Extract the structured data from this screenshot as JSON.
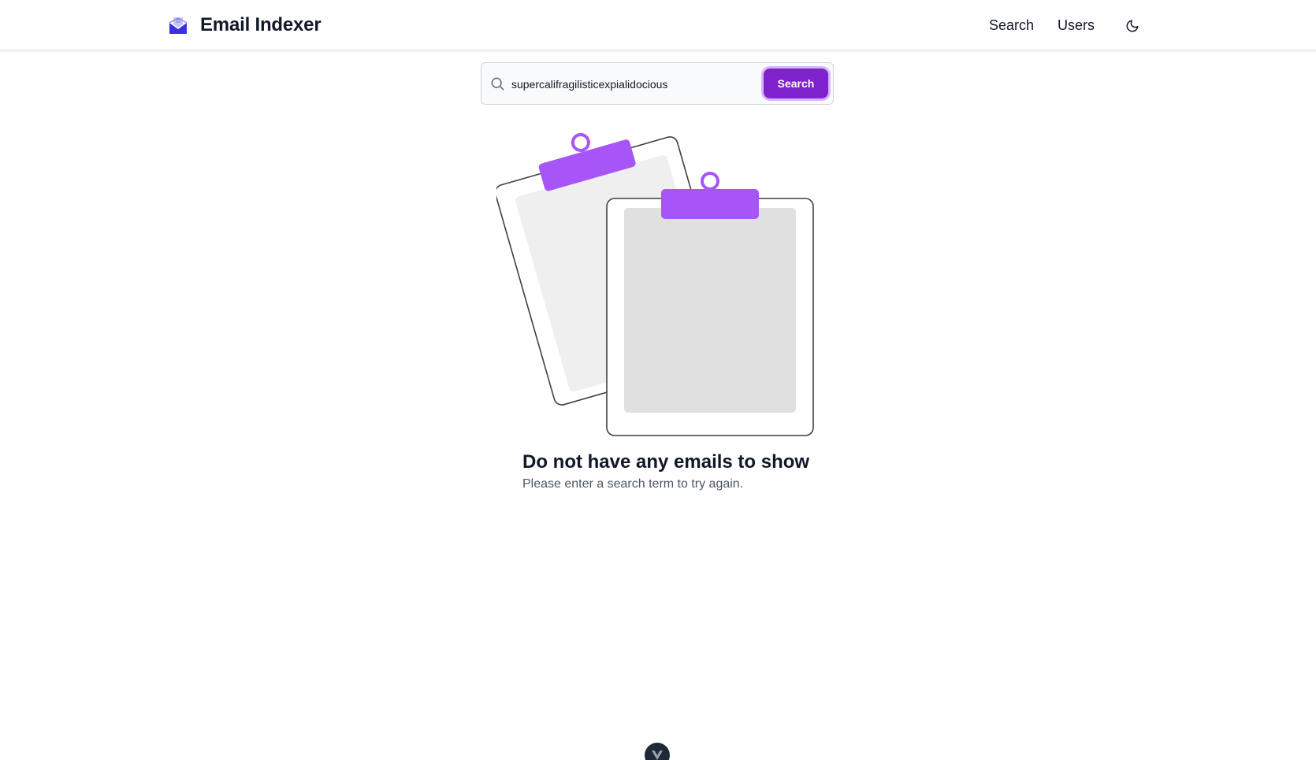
{
  "header": {
    "brand_title": "Email Indexer",
    "brand_icon": "envelope-open-icon",
    "nav": {
      "search_label": "Search",
      "users_label": "Users"
    },
    "theme_toggle_icon": "moon-icon"
  },
  "search": {
    "icon": "search-icon",
    "query": "supercalifragilisticexpialidocious",
    "button_label": "Search"
  },
  "empty_state": {
    "illustration": "clipboards-illustration",
    "title": "Do not have any emails to show",
    "subtitle": "Please enter a search term to try again."
  },
  "devtools_badge": {
    "icon": "vue-logo-icon"
  },
  "colors": {
    "accent": "#7e22ce",
    "accent_ring": "#d8b4fe",
    "illustration_purple": "#a855f7",
    "brand_blue": "#3b30e6"
  }
}
